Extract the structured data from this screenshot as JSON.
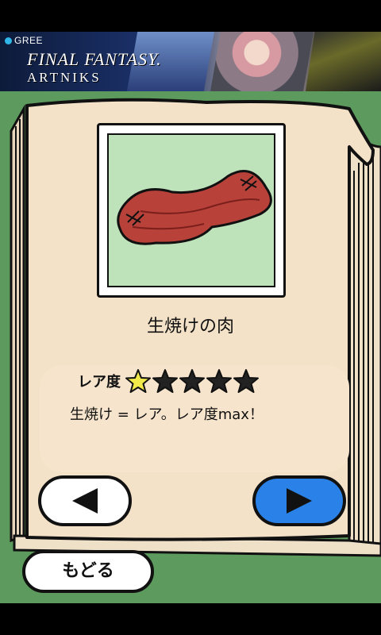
{
  "banner": {
    "brand": "GREE",
    "logo_line1": "FINAL FANTASY.",
    "logo_line2": "ARTNIKS"
  },
  "item": {
    "name": "生焼けの肉",
    "rarity_label": "レア度",
    "rarity_filled": 1,
    "rarity_max": 5,
    "description": "生焼け = レア。レア度max！"
  },
  "nav": {
    "back_label": "もどる"
  },
  "colors": {
    "background_green": "#5c9a5d",
    "page_color": "#f4e2c8",
    "image_bg": "#bee2ba",
    "next_button_blue": "#2a82e8",
    "star_filled": "#f2e94a",
    "meat": "#b8413a"
  },
  "icons": {
    "prev": "triangle-left-icon",
    "next": "triangle-right-icon",
    "star": "star-icon"
  }
}
